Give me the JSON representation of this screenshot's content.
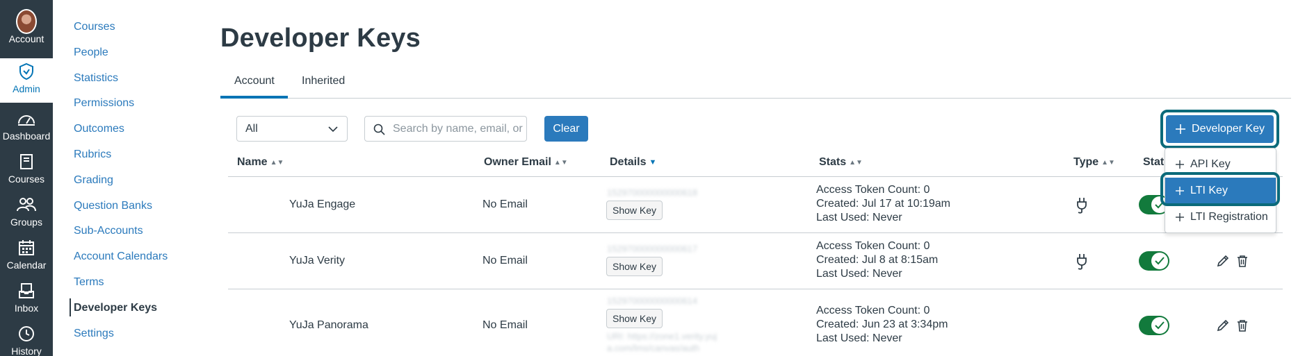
{
  "global_nav": {
    "account": "Account",
    "admin": "Admin",
    "dashboard": "Dashboard",
    "courses": "Courses",
    "groups": "Groups",
    "calendar": "Calendar",
    "inbox": "Inbox",
    "history": "History"
  },
  "sub_nav": {
    "items": [
      "Courses",
      "People",
      "Statistics",
      "Permissions",
      "Outcomes",
      "Rubrics",
      "Grading",
      "Question Banks",
      "Sub-Accounts",
      "Account Calendars",
      "Terms",
      "Developer Keys",
      "Settings"
    ],
    "current": "Developer Keys"
  },
  "page": {
    "title": "Developer Keys",
    "tabs": [
      "Account",
      "Inherited"
    ],
    "active_tab": "Account"
  },
  "filters": {
    "select_value": "All",
    "search_placeholder": "Search by name, email, or",
    "clear_label": "Clear",
    "add_key_label": "Developer Key"
  },
  "table": {
    "headers": [
      "Name",
      "Owner Email",
      "Details",
      "Stats",
      "Type",
      "State"
    ],
    "show_key_label": "Show Key",
    "rows": [
      {
        "name": "YuJa Engage",
        "email": "No Email",
        "key_id": "152970000000000618",
        "stats": [
          "Access Token Count: 0",
          "Created: Jul 17 at 10:19am",
          "Last Used: Never"
        ]
      },
      {
        "name": "YuJa Verity",
        "email": "No Email",
        "key_id": "152970000000000617",
        "stats": [
          "Access Token Count: 0",
          "Created: Jul 8 at 8:15am",
          "Last Used: Never"
        ]
      },
      {
        "name": "YuJa Panorama",
        "email": "No Email",
        "key_id": "152970000000000614",
        "uri": "URI: https://zone1.verity.yuj",
        "uri2": "a.com/lms/canvas/auth",
        "stats": [
          "Access Token Count: 0",
          "Created: Jun 23 at 3:34pm",
          "Last Used: Never"
        ]
      }
    ]
  },
  "menu": {
    "items": [
      "API Key",
      "LTI Key",
      "LTI Registration"
    ],
    "highlighted": "LTI Key"
  },
  "colors": {
    "nav_bg": "#2d3b45",
    "link": "#2b7abc",
    "primary": "#2b7abc",
    "focus_ring": "#0b6a7a",
    "toggle_on": "#127a3c"
  },
  "icons": {
    "type": "plug-icon",
    "edit": "pencil-icon",
    "delete": "trash-icon"
  }
}
